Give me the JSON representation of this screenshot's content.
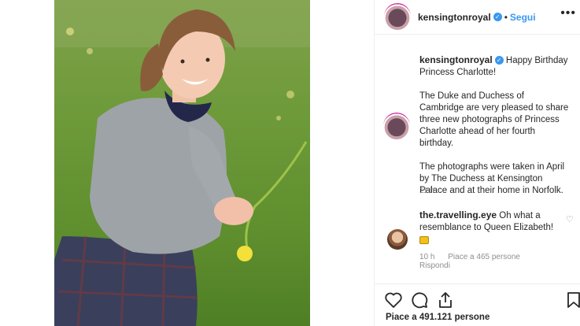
{
  "post": {
    "username": "kensingtonroyal",
    "follow_label": "Segui",
    "caption_greeting": "Happy Birthday Princess Charlotte!",
    "caption_p2": "The Duke and Duchess of Cambridge are very pleased to share three new photographs of Princess Charlotte ahead of her fourth birthday.",
    "caption_p3": "The photographs were taken in April by The Duchess at Kensington Palace and at their home in Norfolk.",
    "caption_time": "11 h"
  },
  "comment": {
    "username": "the.travelling.eye",
    "text": "Oh what a resemblance to Queen Elizabeth!",
    "time": "10 h",
    "likes": "Piace a 465 persone",
    "reply_label": "Rispondi"
  },
  "footer": {
    "likes": "Piace a 491.121 persone"
  },
  "icons": [
    "verified-badge-icon",
    "more-options-icon",
    "heart-icon",
    "comment-icon",
    "share-icon",
    "bookmark-icon",
    "comment-heart-icon"
  ],
  "colors": {
    "link_blue": "#3897f0",
    "muted": "#8e8e8e",
    "text": "#262626",
    "border": "#efefef"
  }
}
